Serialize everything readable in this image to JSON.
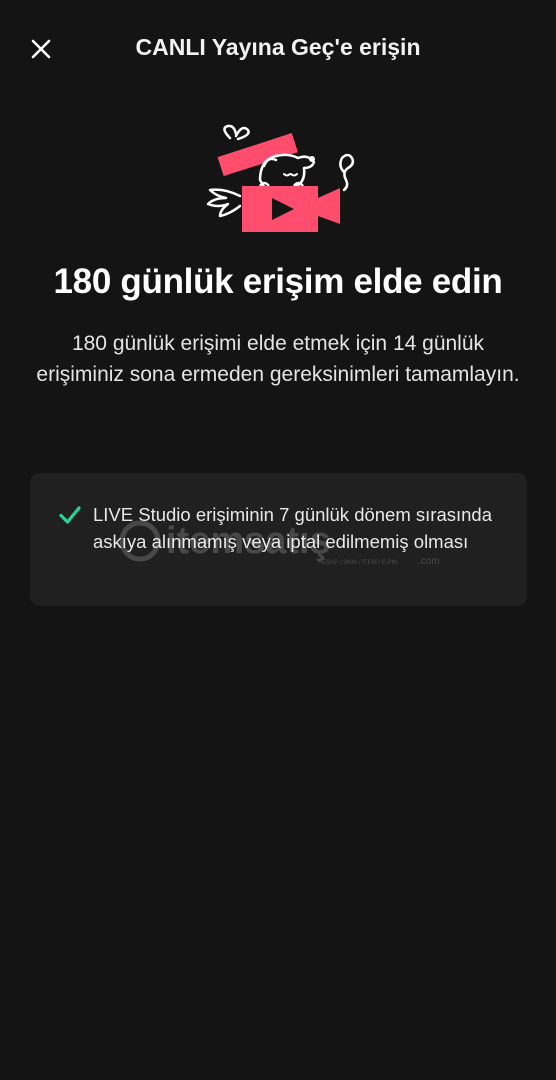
{
  "header": {
    "title": "CANLI Yayına Geç'e erişin"
  },
  "main": {
    "headline": "180 günlük erişim elde edin",
    "description": "180 günlük erişimi elde etmek için 14 günlük erişiminiz sona ermeden gereksinimleri tamamlayın."
  },
  "requirements": [
    {
      "text": "LIVE Studio erişiminin 7 günlük dönem sırasında askıya alınmamış veya iptal edilmemiş olması",
      "status_icon": "check-icon"
    }
  ],
  "watermark": {
    "text": "itemsatış",
    "subtext": "HESAP / SKIN / ITEM / E-PIN",
    "suffix": ".com"
  },
  "colors": {
    "background": "#141414",
    "card": "#202020",
    "accent_pink": "#ff4d6d",
    "check_green": "#25d39b"
  },
  "icons": {
    "close": "close-icon",
    "illustration": "gift-box-dog-camera-illustration"
  }
}
